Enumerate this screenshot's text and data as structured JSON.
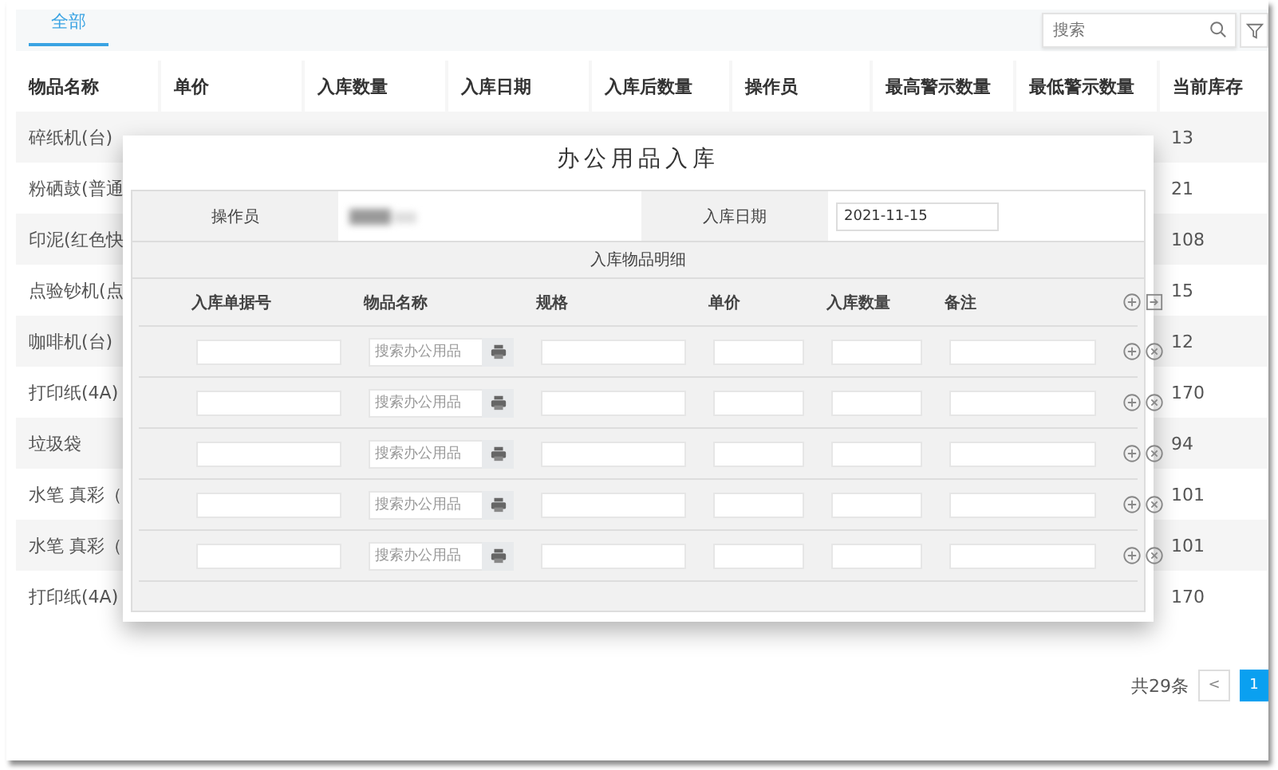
{
  "tabs": [
    {
      "label": "全部",
      "selected": true
    }
  ],
  "search": {
    "placeholder": "搜索"
  },
  "table": {
    "columns": [
      "物品名称",
      "单价",
      "入库数量",
      "入库日期",
      "入库后数量",
      "操作员",
      "最高警示数量",
      "最低警示数量",
      "当前库存"
    ],
    "rows": [
      {
        "item": "碎纸机(台)",
        "stock": "13"
      },
      {
        "item": "粉硒鼓(普通",
        "stock": "21"
      },
      {
        "item": "印泥(红色快",
        "stock": "108"
      },
      {
        "item": "点验钞机(点",
        "stock": "15"
      },
      {
        "item": "咖啡机(台)",
        "stock": "12"
      },
      {
        "item": "打印纸(4A)",
        "stock": "170"
      },
      {
        "item": "垃圾袋",
        "stock": "94"
      },
      {
        "item": "水笔 真彩（",
        "stock": "101"
      },
      {
        "item": "水笔 真彩（",
        "stock": "101"
      },
      {
        "item": "打印纸(4A)",
        "stock": "170"
      }
    ]
  },
  "pagination": {
    "total": "共29条",
    "prev": "<",
    "pages": [
      {
        "label": "1",
        "selected": true
      }
    ]
  },
  "dialog": {
    "title": "办公用品入库",
    "operator_label": "操作员",
    "date_label": "入库日期",
    "date_value": "2021-11-15",
    "section": "入库物品明细",
    "columns": [
      "入库单据号",
      "物品名称",
      "规格",
      "单价",
      "入库数量",
      "备注"
    ],
    "rows": [
      {
        "item_placeholder": "搜索办公用品"
      },
      {
        "item_placeholder": "搜索办公用品"
      },
      {
        "item_placeholder": "搜索办公用品"
      },
      {
        "item_placeholder": "搜索办公用品"
      },
      {
        "item_placeholder": "搜索办公用品"
      }
    ]
  }
}
